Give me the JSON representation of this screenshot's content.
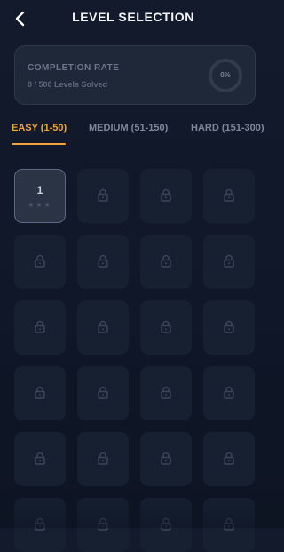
{
  "header": {
    "title": "LEVEL SELECTION",
    "back_icon": "chevron-left-icon"
  },
  "completion": {
    "title": "COMPLETION RATE",
    "subtitle": "0 / 500 Levels Solved",
    "percent_label": "0%",
    "progress_fraction": 0
  },
  "tabs": [
    {
      "label": "EASY (1-50)",
      "active": true
    },
    {
      "label": "MEDIUM (51-150)",
      "active": false
    },
    {
      "label": "HARD (151-300)",
      "active": false
    }
  ],
  "levels": [
    {
      "number": "1",
      "stars": "★★★",
      "locked": false
    },
    {
      "locked": true
    },
    {
      "locked": true
    },
    {
      "locked": true
    },
    {
      "locked": true
    },
    {
      "locked": true
    },
    {
      "locked": true
    },
    {
      "locked": true
    },
    {
      "locked": true
    },
    {
      "locked": true
    },
    {
      "locked": true
    },
    {
      "locked": true
    },
    {
      "locked": true
    },
    {
      "locked": true
    },
    {
      "locked": true
    },
    {
      "locked": true
    },
    {
      "locked": true
    },
    {
      "locked": true
    },
    {
      "locked": true
    },
    {
      "locked": true
    },
    {
      "locked": true
    },
    {
      "locked": true
    },
    {
      "locked": true
    },
    {
      "locked": true
    }
  ],
  "colors": {
    "accent": "#f0a43a",
    "background": "#121a2c",
    "card": "#1f2838",
    "locked_tile": "#162031"
  }
}
